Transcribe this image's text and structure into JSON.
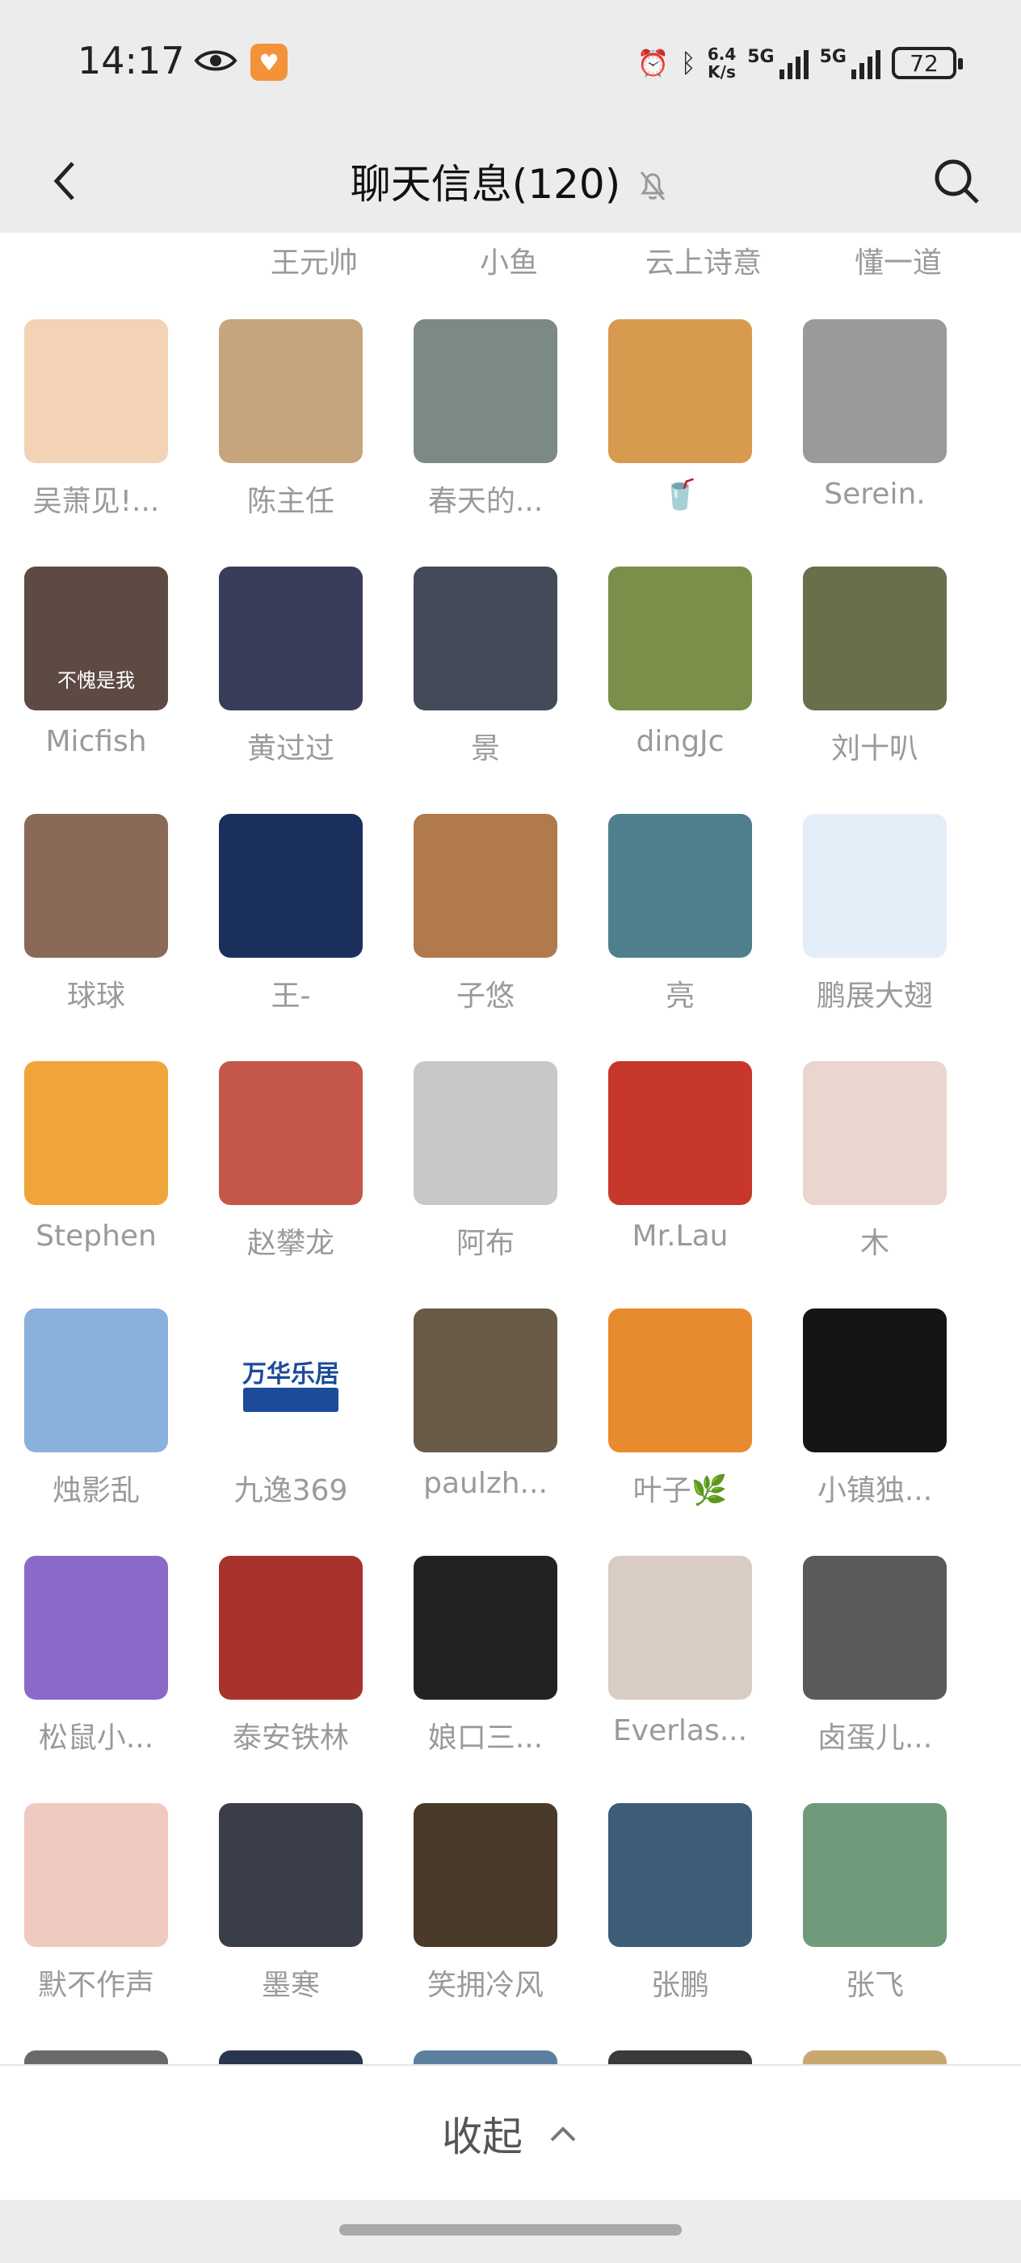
{
  "status": {
    "time": "14:17",
    "net_speed_value": "6.4",
    "net_speed_unit": "K/s",
    "sim1": "5G",
    "sim2": "5G",
    "battery": "72"
  },
  "header": {
    "title": "聊天信息(120)"
  },
  "members_partial": [
    "王元帅",
    "小鱼",
    "云上诗意",
    "懂一道"
  ],
  "members": [
    {
      "name": "吴萧见!...",
      "color": "#f3d2b5"
    },
    {
      "name": "陈主任",
      "color": "#c6a57c"
    },
    {
      "name": "春天的...",
      "color": "#7c8a86"
    },
    {
      "name": "🥤",
      "color": "#d79a4f"
    },
    {
      "name": "Serein.",
      "color": "#9a9a9a"
    },
    {
      "name": "Micfish",
      "color": "#5d4a42",
      "overlay": "不愧是我"
    },
    {
      "name": "黄过过",
      "color": "#3a3d5a"
    },
    {
      "name": "景",
      "color": "#434a58"
    },
    {
      "name": "dingJc",
      "color": "#7a8f4a"
    },
    {
      "name": "刘十叭",
      "color": "#6a6e4a"
    },
    {
      "name": "球球",
      "color": "#8a6a56"
    },
    {
      "name": "王-",
      "color": "#1b2f5c"
    },
    {
      "name": "子悠",
      "color": "#b07a4c"
    },
    {
      "name": "亮",
      "color": "#4f7f8c"
    },
    {
      "name": "鹏展大翅",
      "color": "#e4eef8"
    },
    {
      "name": "Stephen",
      "color": "#f0a53a"
    },
    {
      "name": "赵攀龙",
      "color": "#c4574a"
    },
    {
      "name": "阿布",
      "color": "#c8c8c8"
    },
    {
      "name": "Mr.Lau",
      "color": "#c7372c"
    },
    {
      "name": "木",
      "color": "#ead6cf"
    },
    {
      "name": "烛影乱",
      "color": "#8ab0dc"
    },
    {
      "name": "九逸369",
      "color": "#ffffff",
      "logo": "万华乐居"
    },
    {
      "name": "paulzh...",
      "color": "#6a5a48"
    },
    {
      "name": "叶子🌿",
      "color": "#e88b2e"
    },
    {
      "name": "小镇独...",
      "color": "#151515"
    },
    {
      "name": "松鼠小...",
      "color": "#8a6ac9"
    },
    {
      "name": "泰安铁林",
      "color": "#a8322c"
    },
    {
      "name": "娘口三...",
      "color": "#222222"
    },
    {
      "name": "Everlas...",
      "color": "#d9ccc4"
    },
    {
      "name": "卤蛋儿...",
      "color": "#5a5a5a"
    },
    {
      "name": "默不作声",
      "color": "#f0c9c0"
    },
    {
      "name": "墨寒",
      "color": "#3a3e48"
    },
    {
      "name": "笑拥冷风",
      "color": "#4a3a2a"
    },
    {
      "name": "张鹏",
      "color": "#3e5c78"
    },
    {
      "name": "张飞",
      "color": "#6f9b7a"
    }
  ],
  "bottom_row_colors": [
    "#6a6a6a",
    "#2a3550",
    "#5c7fa0",
    "#3a3a3a",
    "#c9a870"
  ],
  "footer": {
    "collapse_label": "收起"
  }
}
